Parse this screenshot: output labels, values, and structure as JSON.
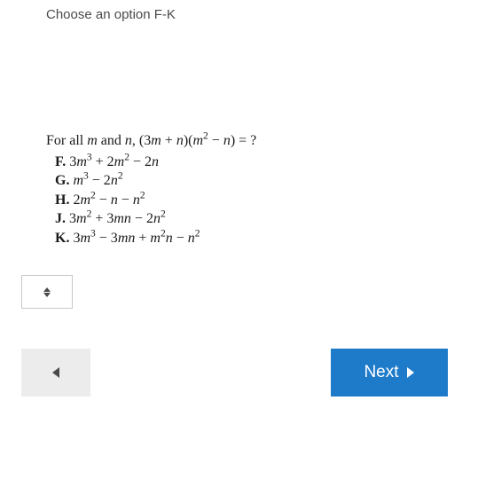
{
  "instruction": "Choose an option F-K",
  "question": {
    "prompt_html": "For all <span class='ital'>m</span> and <span class='ital'>n</span>, (3<span class='ital'>m</span> + <span class='ital'>n</span>)(<span class='ital'>m</span><sup>2</sup> − <span class='ital'>n</span>) = ?",
    "options": [
      {
        "label": "F.",
        "expression_html": "3<span class='ital'>m</span><sup>3</sup> + 2<span class='ital'>m</span><sup>2</sup> − 2<span class='ital'>n</span>"
      },
      {
        "label": "G.",
        "expression_html": "<span class='ital'>m</span><sup>3</sup> − 2<span class='ital'>n</span><sup>2</sup>"
      },
      {
        "label": "H.",
        "expression_html": "2<span class='ital'>m</span><sup>2</sup> − <span class='ital'>n</span> − <span class='ital'>n</span><sup>2</sup>"
      },
      {
        "label": "J.",
        "expression_html": "3<span class='ital'>m</span><sup>2</sup> + 3<span class='ital'>mn</span> − 2<span class='ital'>n</span><sup>2</sup>"
      },
      {
        "label": "K.",
        "expression_html": "3<span class='ital'>m</span><sup>3</sup> − 3<span class='ital'>mn</span> + <span class='ital'>m</span><sup>2</sup><span class='ital'>n</span> − <span class='ital'>n</span><sup>2</sup>"
      }
    ]
  },
  "navigation": {
    "next_label": "Next"
  },
  "icons": {
    "updown": "updown-icon",
    "triangle_left": "triangle-left-icon",
    "triangle_right": "triangle-right-icon"
  }
}
